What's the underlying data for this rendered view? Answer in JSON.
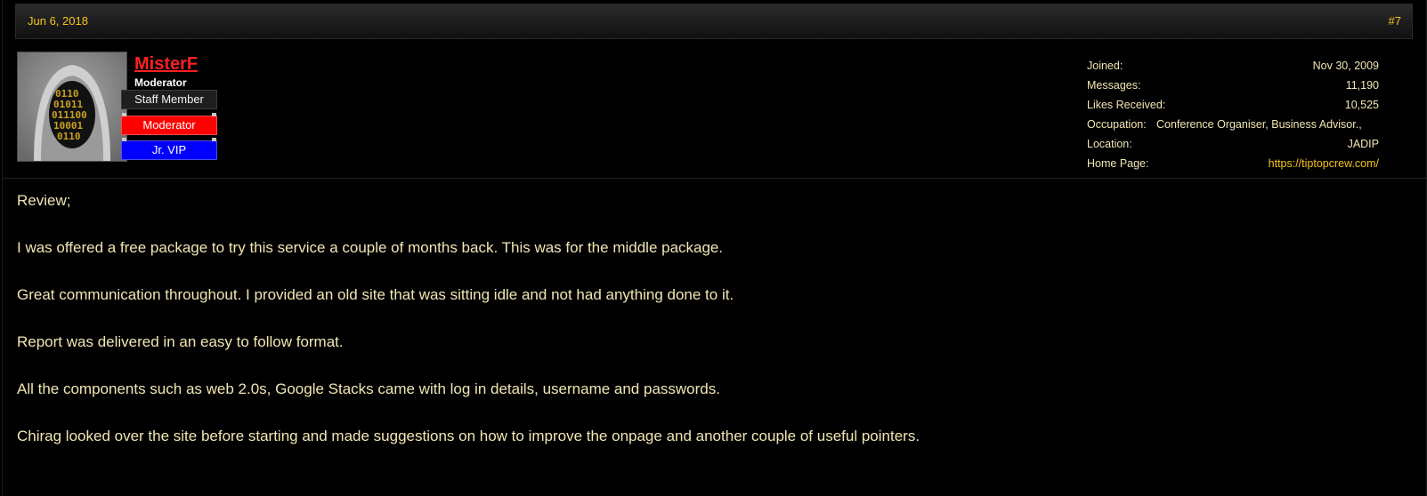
{
  "post": {
    "date": "Jun 6, 2018",
    "number": "#7"
  },
  "user": {
    "username": "MisterF",
    "title": "Moderator",
    "banners": [
      "Staff Member",
      "Moderator",
      "Jr. VIP"
    ],
    "avatar_icon": "hooded-figure-binary-avatar"
  },
  "stats": [
    {
      "label": "Joined:",
      "value": "Nov 30, 2009"
    },
    {
      "label": "Messages:",
      "value": "11,190"
    },
    {
      "label": "Likes Received:",
      "value": "10,525"
    },
    {
      "label": "Occupation:",
      "value": "Conference Organiser, Business Advisor.,"
    },
    {
      "label": "Location:",
      "value": "JADIP"
    },
    {
      "label": "Home Page:",
      "value": "https://tiptopcrew.com/"
    }
  ],
  "message": [
    "Review;",
    "I was offered a free package to try this service a couple of months back. This was for the middle package.",
    "Great communication throughout. I provided an old site that was sitting idle and not had anything done to it.",
    "Report was delivered in an easy to follow format.",
    "All the components such as web 2.0s, Google Stacks came with log in details, username and passwords.",
    "Chirag looked over the site before starting and made suggestions on how to improve the onpage and another couple of useful pointers."
  ],
  "colors": {
    "accent": "#f7c31c",
    "username": "#ff2020",
    "moderator_banner": "#ff0000",
    "vip_banner": "#0000ff",
    "text": "#f0e6b0"
  }
}
